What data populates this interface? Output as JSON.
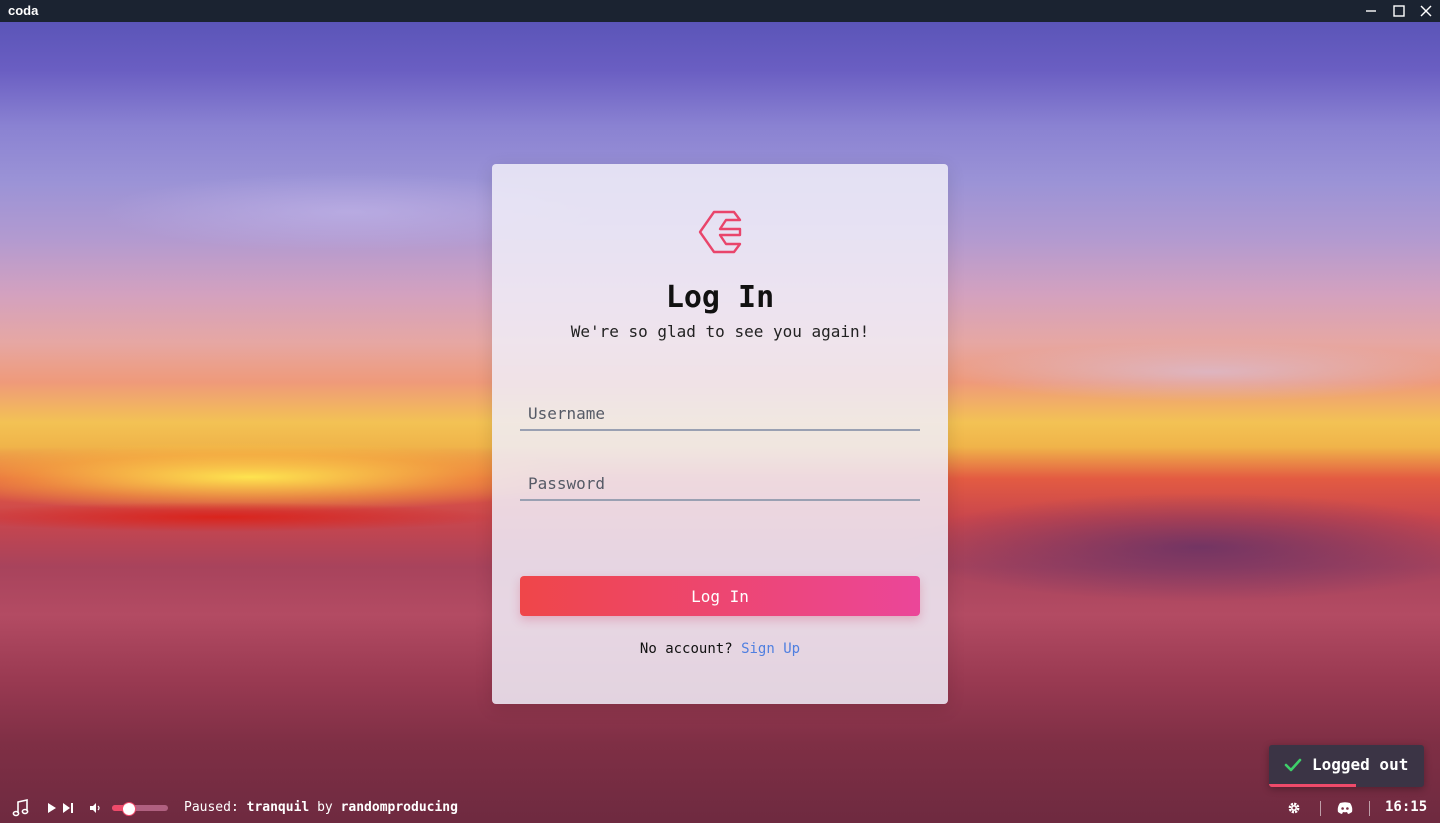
{
  "window": {
    "title": "coda",
    "controls": {
      "minimize_icon": "minimize-icon",
      "maximize_icon": "maximize-icon",
      "close_icon": "close-icon"
    }
  },
  "login": {
    "logo_icon": "coda-logo",
    "title": "Log In",
    "subtitle": "We're so glad to see you again!",
    "username": {
      "placeholder": "Username",
      "value": ""
    },
    "password": {
      "placeholder": "Password",
      "value": ""
    },
    "submit_label": "Log In",
    "no_account_text": "No account?",
    "signup_label": "Sign Up"
  },
  "toast": {
    "icon": "check-icon",
    "message": "Logged out"
  },
  "player": {
    "status_label": "Paused:",
    "track": "tranquil",
    "by_label": "by",
    "artist": "randomproducing",
    "volume": 0.25
  },
  "statusbar": {
    "time": "16:15"
  },
  "colors": {
    "accent": "#ef4a6a",
    "button_gradient_start": "#ef4649",
    "button_gradient_end": "#eb4699",
    "link": "#4f7fe0",
    "titlebar": "#1b2331",
    "toast_bg": "#3b3445"
  }
}
